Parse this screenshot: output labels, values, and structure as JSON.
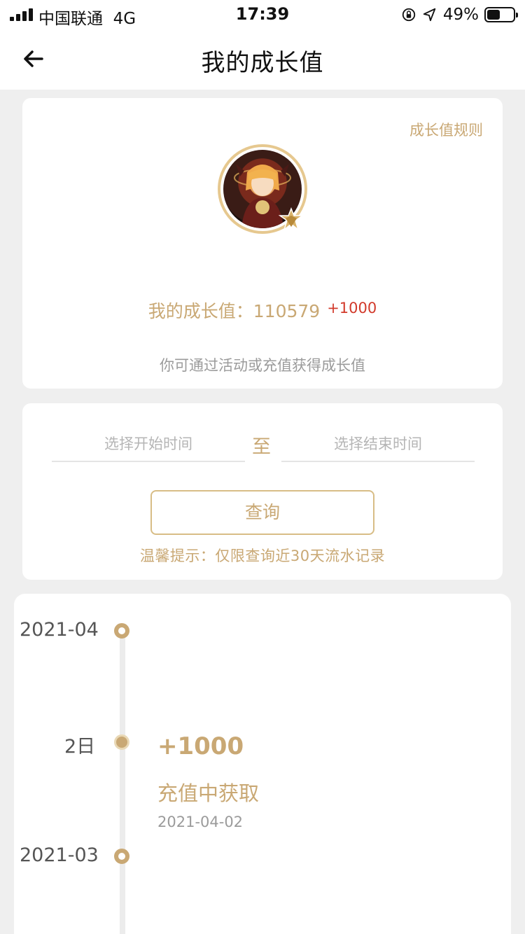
{
  "status_bar": {
    "carrier": "中国联通",
    "network": "4G",
    "time": "17:39",
    "battery_percent": "49%",
    "battery_level": 0.49
  },
  "nav": {
    "title": "我的成长值",
    "back_icon": "back-arrow-icon"
  },
  "growth_card": {
    "rules_link": "成长值规则",
    "label": "我的成长值：",
    "value": "110579",
    "delta": "+1000",
    "hint": "你可通过活动或充值获得成长值",
    "accent_color": "#c9a874",
    "delta_color": "#d23a2b"
  },
  "query_card": {
    "start_placeholder": "选择开始时间",
    "separator": "至",
    "end_placeholder": "选择结束时间",
    "button_label": "查询",
    "tip": "温馨提示：仅限查询近30天流水记录"
  },
  "timeline": {
    "months": [
      "2021-04",
      "2021-03"
    ],
    "entries": [
      {
        "day": "2日",
        "amount": "+1000",
        "source": "充值中获取",
        "date": "2021-04-02"
      }
    ]
  }
}
